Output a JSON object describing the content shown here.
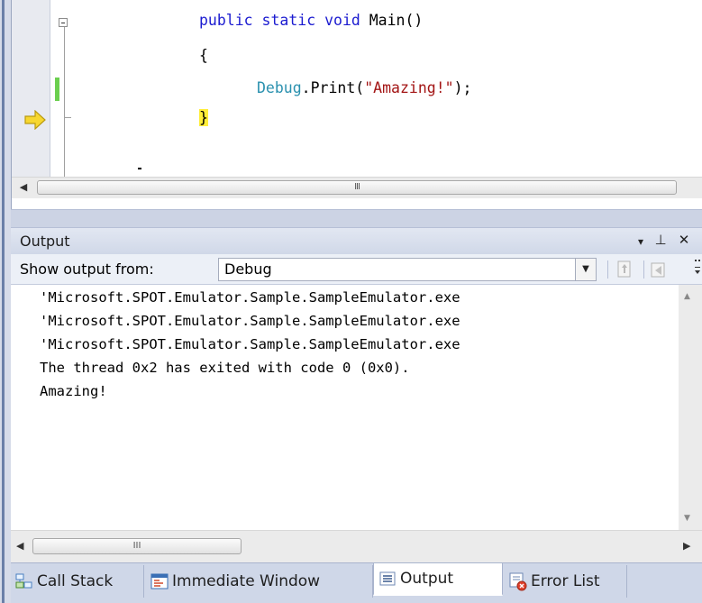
{
  "editor": {
    "code_lines": {
      "line1_kw": "public static void",
      "line1_rest": " Main()",
      "line2": "{",
      "line3_type": "Debug",
      "line3_call": ".Print(",
      "line3_string": "\"Amazing!\"",
      "line3_end": ");",
      "line4": "}"
    },
    "hscroll_grip": "III"
  },
  "output": {
    "title": "Output",
    "pin_glyph": "٢",
    "close_glyph": "✕",
    "dropdown_glyph": "▾",
    "show_output_from_label": "Show output from:",
    "source_selected": "Debug",
    "lines": [
      "'Microsoft.SPOT.Emulator.Sample.SampleEmulator.exe",
      "'Microsoft.SPOT.Emulator.Sample.SampleEmulator.exe",
      "'Microsoft.SPOT.Emulator.Sample.SampleEmulator.exe",
      "The thread 0x2 has exited with code 0 (0x0).",
      "Amazing!"
    ],
    "hscroll_grip": "III"
  },
  "tabs": [
    {
      "label": "Call Stack",
      "icon": "call-stack-icon"
    },
    {
      "label": "Immediate Window",
      "icon": "immediate-window-icon"
    },
    {
      "label": "Output",
      "icon": "output-icon",
      "active": true
    },
    {
      "label": "Error List",
      "icon": "error-list-icon"
    }
  ],
  "colors": {
    "keyword": "#1b1bd0",
    "type": "#2b91af",
    "string": "#a31515",
    "brace_highlight": "#ffee3a",
    "change_bar": "#6bcf4f",
    "exec_arrow": "#f7d72f"
  }
}
